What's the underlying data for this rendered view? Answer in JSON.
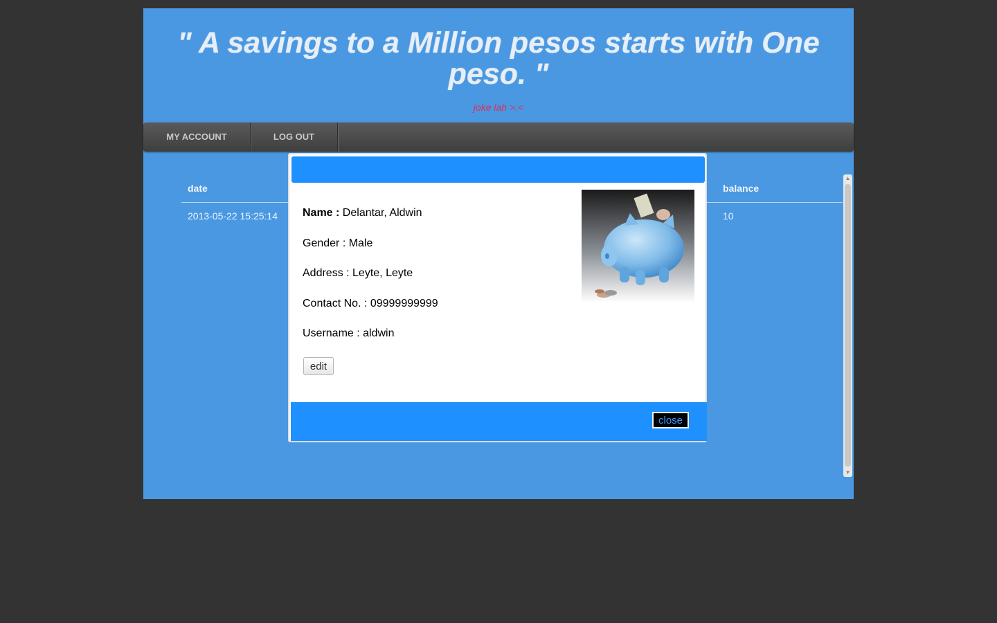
{
  "header": {
    "quote_line1": "\" A savings to a Million pesos starts with One",
    "quote_line2": "peso. \"",
    "subtitle": "joke lah >.<"
  },
  "nav": {
    "items": [
      {
        "label": "MY ACCOUNT"
      },
      {
        "label": "LOG OUT"
      }
    ]
  },
  "table": {
    "headers": [
      "date",
      "balance"
    ],
    "rows": [
      {
        "date": "2013-05-22 15:25:14",
        "balance": "10"
      }
    ]
  },
  "modal": {
    "name_label": "Name :",
    "name_value": " Delantar, Aldwin",
    "gender": "Gender : Male",
    "address": "Address : Leyte, Leyte",
    "contact": "Contact No. : 09999999999",
    "username": "Username : aldwin",
    "edit_label": "edit",
    "close_label": "close",
    "image_icon": "piggy-bank-icon"
  },
  "colors": {
    "page_bg": "#4a98e2",
    "modal_bar": "#1e90ff",
    "subtitle": "#e03050",
    "outer_bg": "#333333"
  }
}
